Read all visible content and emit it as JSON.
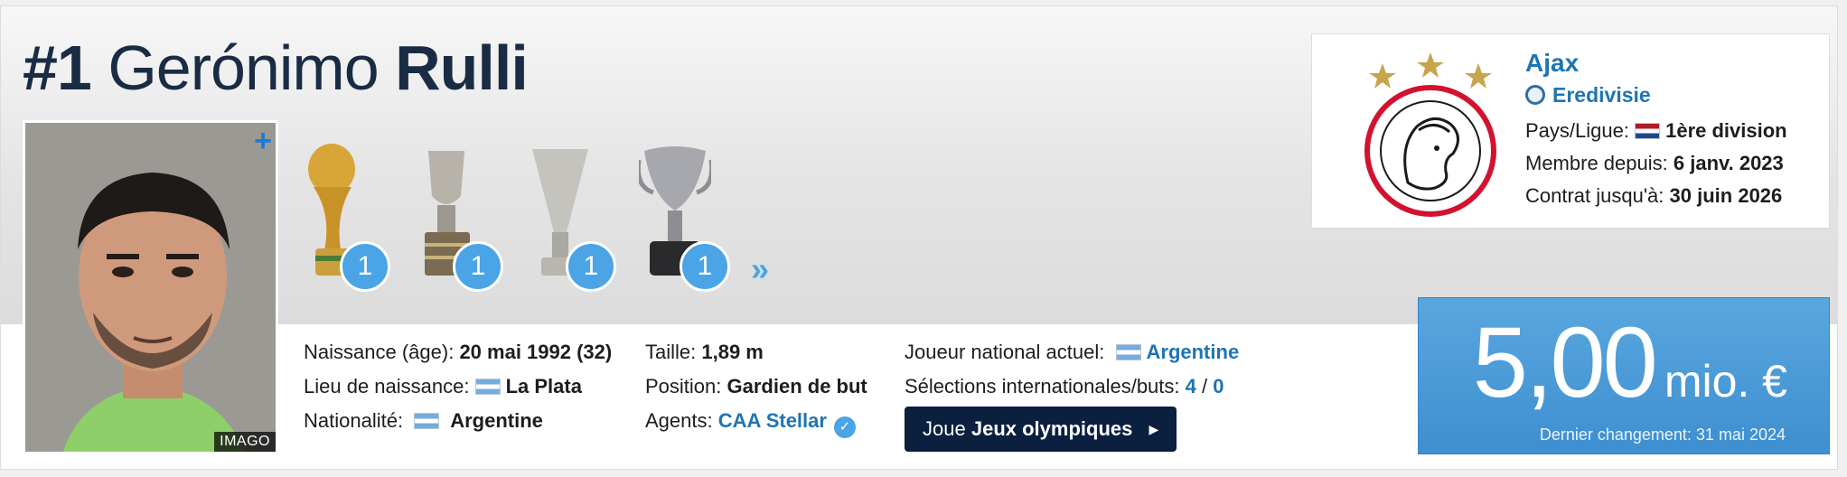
{
  "player": {
    "number": "#1",
    "first_name": "Gerónimo",
    "last_name": "Rulli",
    "photo_credit": "IMAGO"
  },
  "trophies": [
    {
      "name": "world-cup-trophy",
      "count": "1"
    },
    {
      "name": "copa-america-trophy",
      "count": "1"
    },
    {
      "name": "europa-league-trophy",
      "count": "1"
    },
    {
      "name": "super-cup-trophy",
      "count": "1"
    }
  ],
  "club": {
    "name": "Ajax",
    "league": "Eredivisie",
    "country_league_label": "Pays/Ligue:",
    "country_league_value": "1ère division",
    "member_since_label": "Membre depuis:",
    "member_since_value": "6 janv. 2023",
    "contract_label": "Contrat jusqu'à:",
    "contract_value": "30 juin 2026"
  },
  "market_value": {
    "amount": "5,00",
    "unit": "mio. €",
    "last_change": "Dernier changement: 31 mai 2024"
  },
  "info": {
    "birth_label": "Naissance (âge):",
    "birth_value": "20 mai 1992 (32)",
    "birthplace_label": "Lieu de naissance:",
    "birthplace_value": "La Plata",
    "nationality_label": "Nationalité:",
    "nationality_value": "Argentine",
    "height_label": "Taille:",
    "height_value": "1,89 m",
    "position_label": "Position:",
    "position_value": "Gardien de but",
    "agents_label": "Agents:",
    "agents_value": "CAA Stellar",
    "national_label": "Joueur national actuel:",
    "national_value": "Argentine",
    "caps_label": "Sélections internationales/buts:",
    "caps_value": "4",
    "caps_sep": "/",
    "goals_value": "0"
  },
  "olympics_button": {
    "prefix": "Joue",
    "label": "Jeux olympiques"
  },
  "colors": {
    "link": "#1d75b3",
    "badge": "#4aa4e6",
    "value_box": "#4a9ad8",
    "button": "#0b1f3f",
    "headline": "#1a2c44"
  }
}
